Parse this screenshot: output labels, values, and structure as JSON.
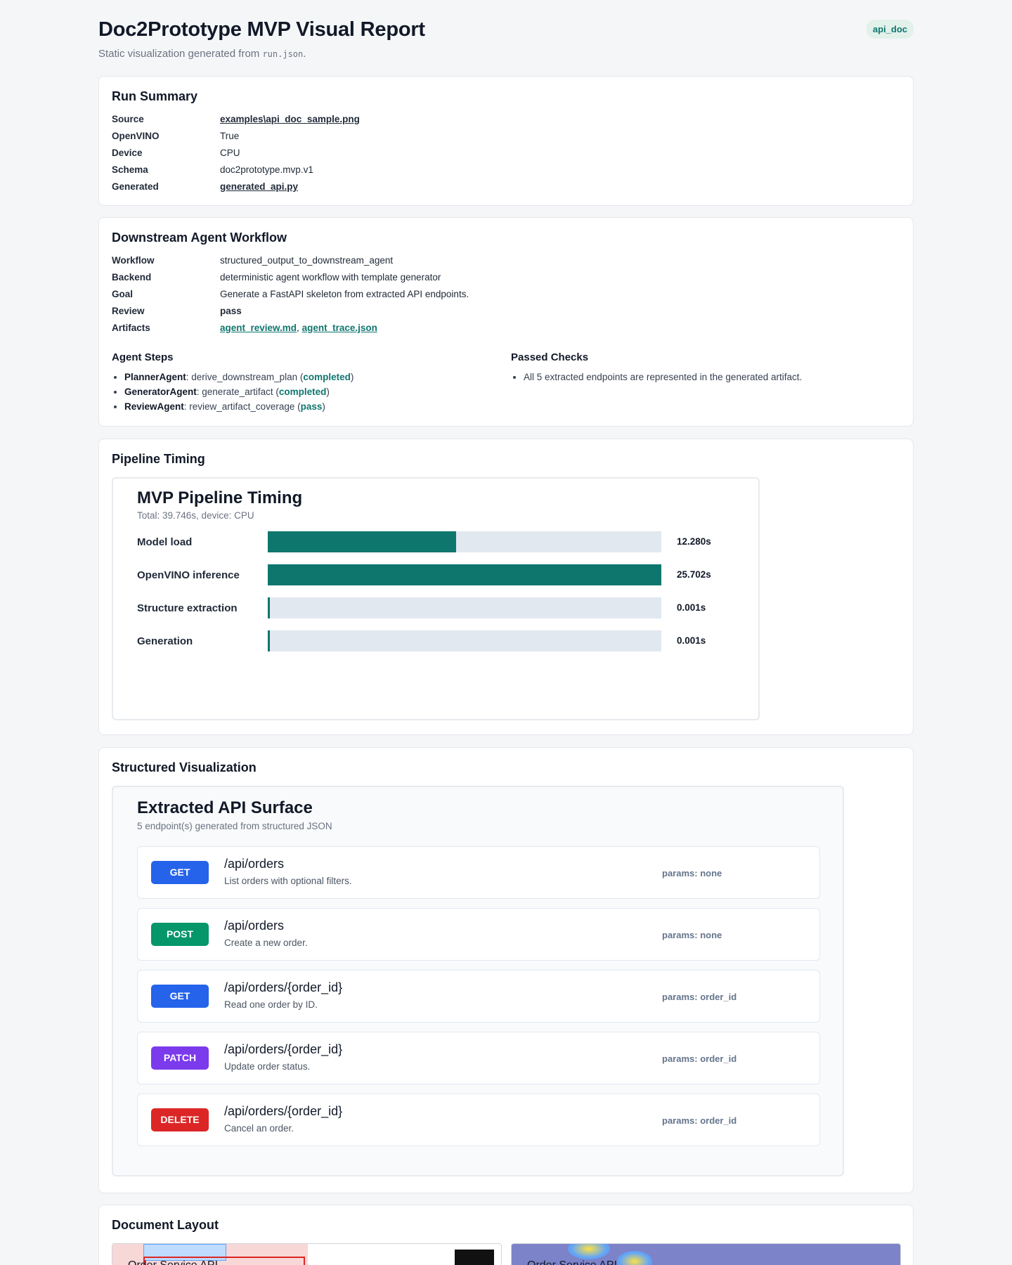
{
  "header": {
    "title": "Doc2Prototype MVP Visual Report",
    "subtitle_prefix": "Static visualization generated from ",
    "subtitle_file": "run.json",
    "subtitle_suffix": ".",
    "badge": "api_doc"
  },
  "run_summary": {
    "title": "Run Summary",
    "rows": [
      {
        "key": "Source",
        "value": "examples\\api_doc_sample.png",
        "is_link": true
      },
      {
        "key": "OpenVINO",
        "value": "True",
        "is_link": false
      },
      {
        "key": "Device",
        "value": "CPU",
        "is_link": false
      },
      {
        "key": "Schema",
        "value": "doc2prototype.mvp.v1",
        "is_link": false
      },
      {
        "key": "Generated",
        "value": "generated_api.py",
        "is_link": true
      }
    ]
  },
  "workflow": {
    "title": "Downstream Agent Workflow",
    "rows": {
      "workflow": {
        "key": "Workflow",
        "value": "structured_output_to_downstream_agent"
      },
      "backend": {
        "key": "Backend",
        "value": "deterministic agent workflow with template generator"
      },
      "goal": {
        "key": "Goal",
        "value": "Generate a FastAPI skeleton from extracted API endpoints."
      },
      "review": {
        "key": "Review",
        "value": "pass"
      },
      "artifacts": {
        "key": "Artifacts",
        "link1": "agent_review.md",
        "sep": ", ",
        "link2": "agent_trace.json"
      }
    },
    "steps_title": "Agent Steps",
    "steps": [
      {
        "agent": "PlannerAgent",
        "action": ": derive_downstream_plan (",
        "status": "completed",
        "close": ")"
      },
      {
        "agent": "GeneratorAgent",
        "action": ": generate_artifact (",
        "status": "completed",
        "close": ")"
      },
      {
        "agent": "ReviewAgent",
        "action": ": review_artifact_coverage (",
        "status": "pass",
        "close": ")"
      }
    ],
    "checks_title": "Passed Checks",
    "checks": [
      "All 5 extracted endpoints are represented in the generated artifact."
    ]
  },
  "timing": {
    "section_title": "Pipeline Timing",
    "title": "MVP Pipeline Timing",
    "subtitle": "Total: 39.746s, device: CPU",
    "max": 25.702,
    "bar_color": "#0f766e",
    "track_color": "#e2e8f0",
    "rows": [
      {
        "label": "Model load",
        "value": 12.28,
        "display": "12.280s"
      },
      {
        "label": "OpenVINO inference",
        "value": 25.702,
        "display": "25.702s"
      },
      {
        "label": "Structure extraction",
        "value": 0.001,
        "display": "0.001s"
      },
      {
        "label": "Generation",
        "value": 0.001,
        "display": "0.001s"
      }
    ]
  },
  "structured": {
    "section_title": "Structured Visualization",
    "title": "Extracted API Surface",
    "subtitle": "5 endpoint(s) generated from structured JSON",
    "endpoints": [
      {
        "method": "GET",
        "color": "#2563eb",
        "path": "/api/orders",
        "desc": "List orders with optional filters.",
        "params": "params: none"
      },
      {
        "method": "POST",
        "color": "#059669",
        "path": "/api/orders",
        "desc": "Create a new order.",
        "params": "params: none"
      },
      {
        "method": "GET",
        "color": "#2563eb",
        "path": "/api/orders/{order_id}",
        "desc": "Read one order by ID.",
        "params": "params: order_id"
      },
      {
        "method": "PATCH",
        "color": "#7c3aed",
        "path": "/api/orders/{order_id}",
        "desc": "Update order status.",
        "params": "params: order_id"
      },
      {
        "method": "DELETE",
        "color": "#dc2626",
        "path": "/api/orders/{order_id}",
        "desc": "Cancel an order.",
        "params": "params: order_id"
      }
    ]
  },
  "document_layout": {
    "section_title": "Document Layout",
    "left_preview_text": "Order Service API",
    "right_preview_text": "Order Service API"
  }
}
